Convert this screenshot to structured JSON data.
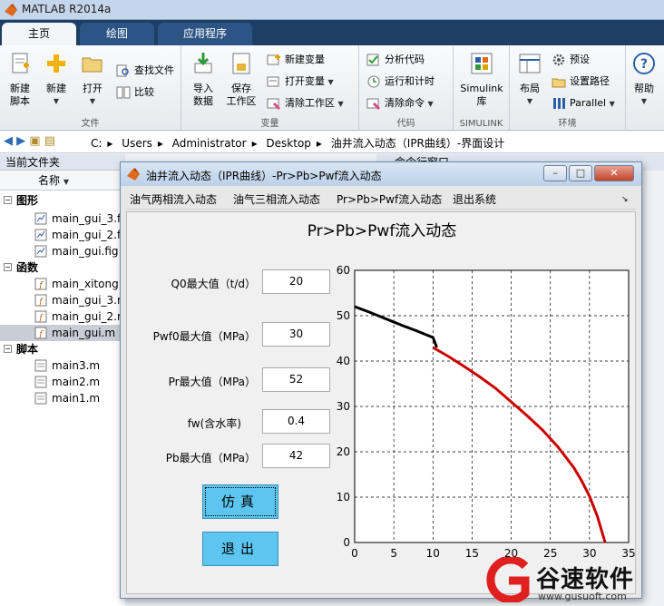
{
  "app": {
    "title": "MATLAB R2014a"
  },
  "ribbon_tabs": [
    {
      "label": "主页",
      "active": true
    },
    {
      "label": "绘图",
      "active": false
    },
    {
      "label": "应用程序",
      "active": false
    }
  ],
  "ribbon": {
    "file_group": {
      "label": "文件",
      "new_script": "新建\n脚本",
      "new": "新建",
      "open": "打开",
      "find_files": "查找文件",
      "compare": "比较"
    },
    "variable_group": {
      "label": "变量",
      "import_data": "导入\n数据",
      "save_workspace": "保存\n工作区",
      "new_variable": "新建变量",
      "open_variable": "打开变量",
      "clear_workspace": "清除工作区"
    },
    "code_group": {
      "label": "代码",
      "analyze_code": "分析代码",
      "run_and_time": "运行和计时",
      "clear_commands": "清除命令"
    },
    "simulink_group": {
      "label": "SIMULINK",
      "simulink_library": "Simulink\n库"
    },
    "environment_group": {
      "label": "环境",
      "layout": "布局",
      "preferences": "预设",
      "set_path": "设置路径",
      "parallel": "Parallel"
    },
    "help": "帮助"
  },
  "address": {
    "segments": [
      "C:",
      "Users",
      "Administrator",
      "Desktop",
      "油井流入动态（IPR曲线）-界面设计"
    ]
  },
  "current_folder": {
    "header": "当前文件夹",
    "column_name": "名称",
    "sections": [
      {
        "label": "图形",
        "files": [
          "main_gui_3.fig",
          "main_gui_2.fig",
          "main_gui.fig"
        ]
      },
      {
        "label": "函数",
        "files": [
          "main_xitong.m",
          "main_gui_3.m",
          "main_gui_2.m",
          "main_gui.m"
        ]
      },
      {
        "label": "脚本",
        "files": [
          "main3.m",
          "main2.m",
          "main1.m"
        ]
      }
    ],
    "selected_file": "main_gui.m"
  },
  "command_window": {
    "header": "命令行窗口"
  },
  "figure": {
    "title": "油井流入动态（IPR曲线）-Pr>Pb>Pwf流入动态",
    "menu": [
      "油气两相流入动态",
      "油气三相流入动态",
      "Pr>Pb>Pwf流入动态",
      "退出系统"
    ],
    "heading": "Pr>Pb>Pwf流入动态",
    "params": [
      {
        "label": "Q0最大值（t/d）",
        "value": "20"
      },
      {
        "label": "Pwf0最大值（MPa）",
        "value": "30"
      },
      {
        "label": "Pr最大值（MPa）",
        "value": "52"
      },
      {
        "label": "fw(含水率)",
        "value": "0.4"
      },
      {
        "label": "Pb最大值（MPa）",
        "value": "42"
      }
    ],
    "simulate_button": "仿真",
    "exit_button": "退出"
  },
  "chart_data": {
    "type": "line",
    "title": "",
    "xlabel": "",
    "ylabel": "",
    "xlim": [
      0,
      35
    ],
    "ylim": [
      0,
      60
    ],
    "xticks": [
      0,
      5,
      10,
      15,
      20,
      25,
      30,
      35
    ],
    "yticks": [
      0,
      10,
      20,
      30,
      40,
      50,
      60
    ],
    "grid": "dashed",
    "series": [
      {
        "color": "#000000",
        "x": [
          0,
          2,
          4,
          6,
          8,
          10,
          10.5
        ],
        "y": [
          52,
          50.7,
          49.3,
          47.9,
          46.6,
          45.2,
          43
        ]
      },
      {
        "color": "#cc0000",
        "x": [
          10,
          12,
          14,
          16,
          18,
          20,
          22,
          24,
          26,
          28,
          29,
          30,
          31,
          32
        ],
        "y": [
          43,
          41,
          38.8,
          36.5,
          34,
          31,
          28,
          24.8,
          21,
          16.5,
          13.6,
          10.2,
          5.8,
          0
        ]
      }
    ]
  },
  "watermark": {
    "text": "谷速软件",
    "url": "www.gusuoft.com"
  }
}
